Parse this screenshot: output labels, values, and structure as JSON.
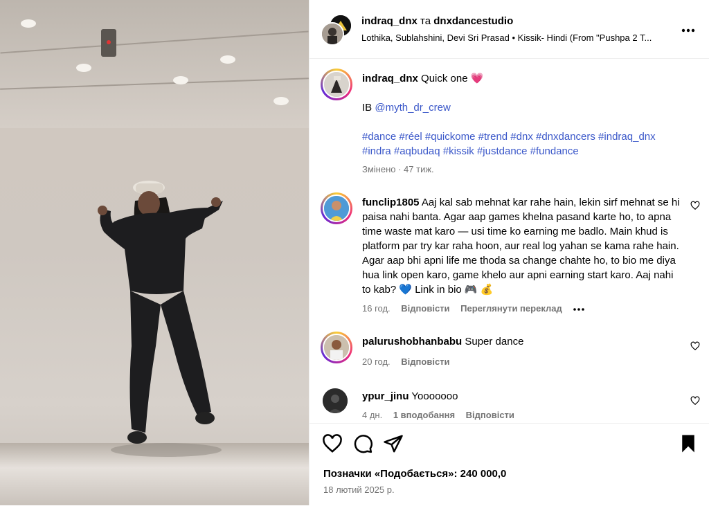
{
  "header": {
    "author": "indraq_dnx",
    "conjunction": "та",
    "collaborator": "dnxdancestudio",
    "audio": "Lothika, Sublahshini, Devi Sri Prasad • Kissik- Hindi (From \"Pushpa 2 T...",
    "more_icon": "more-horizontal-icon"
  },
  "caption": {
    "username": "indraq_dnx",
    "text": "Quick one",
    "emoji": "💗",
    "ib_prefix": "IB",
    "ib_mention": "@myth_dr_crew",
    "hashtags_line1": "#dance #réel #quickome #trend #dnx #dnxdancers #indraq_dnx",
    "hashtags_line2": "#indra #aqbudaq #kissik #justdance #fundance",
    "meta": "Змінено · 47 тиж."
  },
  "comments": [
    {
      "username": "funclip1805",
      "text": "Aaj kal sab mehnat kar rahe hain, lekin sirf mehnat se hi paisa nahi banta. Agar aap games khelna pasand karte ho, to apna time waste mat karo — usi time ko earning me badlo. Main khud is platform par try kar raha hoon, aur real log yahan se kama rahe hain. Agar aap bhi apni life me thoda sa change chahte ho, to bio me diya hua link open karo, game khelo aur apni earning start karo. Aaj nahi to kab? 💙 Link in bio 🎮 💰",
      "time": "16 год.",
      "reply": "Відповісти",
      "translate": "Переглянути переклад"
    },
    {
      "username": "palurushobhanbabu",
      "text": "Super dance",
      "time": "20 год.",
      "reply": "Відповісти"
    },
    {
      "username": "ypur_jinu",
      "text": "Yooooooo",
      "time": "4 дн.",
      "likes": "1 вподобання",
      "reply": "Відповісти"
    }
  ],
  "actions": {
    "likes": "Позначки «Подобається»: 240 000,0",
    "date": "18 лютий 2025 р."
  },
  "colors": {
    "link": "#3a57c9",
    "muted": "#737373",
    "story_ring_start": "#f9ce34",
    "story_ring_mid": "#ee2a7b",
    "story_ring_end": "#6228d7"
  }
}
